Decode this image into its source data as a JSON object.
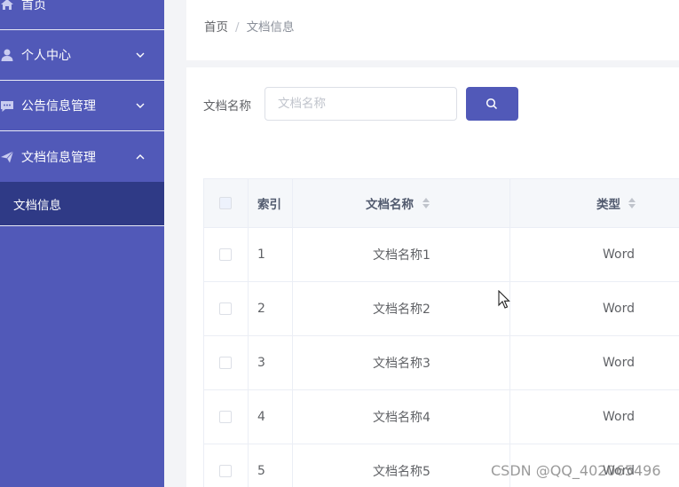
{
  "sidebar": {
    "items": [
      {
        "label": "首页",
        "icon": "home-icon"
      },
      {
        "label": "个人中心",
        "icon": "user-icon"
      },
      {
        "label": "公告信息管理",
        "icon": "chat-icon"
      },
      {
        "label": "文档信息管理",
        "icon": "send-icon",
        "expanded": true
      }
    ],
    "submenu": {
      "label": "文档信息",
      "active": true
    }
  },
  "breadcrumb": {
    "home": "首页",
    "separator": "/",
    "current": "文档信息"
  },
  "search": {
    "label": "文档名称",
    "placeholder": "文档名称",
    "value": "",
    "button_icon": "search-icon"
  },
  "table": {
    "headers": {
      "index": "索引",
      "name": "文档名称",
      "type": "类型"
    },
    "rows": [
      {
        "index": "1",
        "name": "文档名称1",
        "type": "Word"
      },
      {
        "index": "2",
        "name": "文档名称2",
        "type": "Word"
      },
      {
        "index": "3",
        "name": "文档名称3",
        "type": "Word"
      },
      {
        "index": "4",
        "name": "文档名称4",
        "type": "Word"
      },
      {
        "index": "5",
        "name": "文档名称5",
        "type": "Word"
      }
    ]
  },
  "watermark": "CSDN @QQ_402065496",
  "colors": {
    "sidebar": "#5159b8",
    "submenu_active": "#2f3a86",
    "primary_button": "#5159b8",
    "table_header": "#f5f7fa"
  }
}
